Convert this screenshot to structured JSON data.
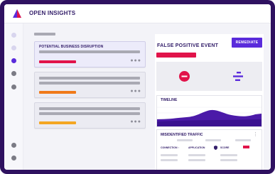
{
  "app": {
    "title": "OPEN INSIGHTS",
    "logo_icon": "triangle-logo-icon"
  },
  "sidebar": {
    "items": [
      {
        "icon": "nav-dot-icon",
        "state": "default",
        "color": "#d8d5ee"
      },
      {
        "icon": "nav-dot-icon",
        "state": "default",
        "color": "#d8d5ee"
      },
      {
        "icon": "nav-dot-icon",
        "state": "active",
        "color": "#5a2bdb"
      },
      {
        "icon": "nav-dot-icon",
        "state": "default",
        "color": "#7b7b85"
      },
      {
        "icon": "nav-dot-icon",
        "state": "default",
        "color": "#7b7b85"
      },
      {
        "icon": "nav-dot-icon",
        "state": "default",
        "color": "#7b7b85"
      },
      {
        "icon": "nav-dot-icon",
        "state": "default",
        "color": "#7b7b85"
      }
    ]
  },
  "list": {
    "cards": [
      {
        "title": "POTENTIAL BUSINESS DISRUPTION",
        "severity_color": "#e1134a",
        "selected": true,
        "more": "●●●"
      },
      {
        "title": "",
        "severity_color": "#f07a1a",
        "selected": false,
        "more": "●●●"
      },
      {
        "title": "",
        "severity_color": "#f4a623",
        "selected": false,
        "more": "●●●"
      }
    ]
  },
  "detail": {
    "title": "FALSE POSITIVE EVENT",
    "remediate_label": "REMEDIATE",
    "accent_color": "#5a2bdb",
    "alert_color": "#e1134a",
    "icons": [
      "block-icon",
      "bars-icon"
    ],
    "timeline": {
      "label": "TIMELINE"
    },
    "traffic": {
      "label": "MISIDENTIFIED TRAFFIC",
      "more": "⋮",
      "columns": [
        "CONNECTION ↑",
        "APPLICATION",
        "SCORE"
      ],
      "shield_icon": "shield-icon"
    }
  }
}
